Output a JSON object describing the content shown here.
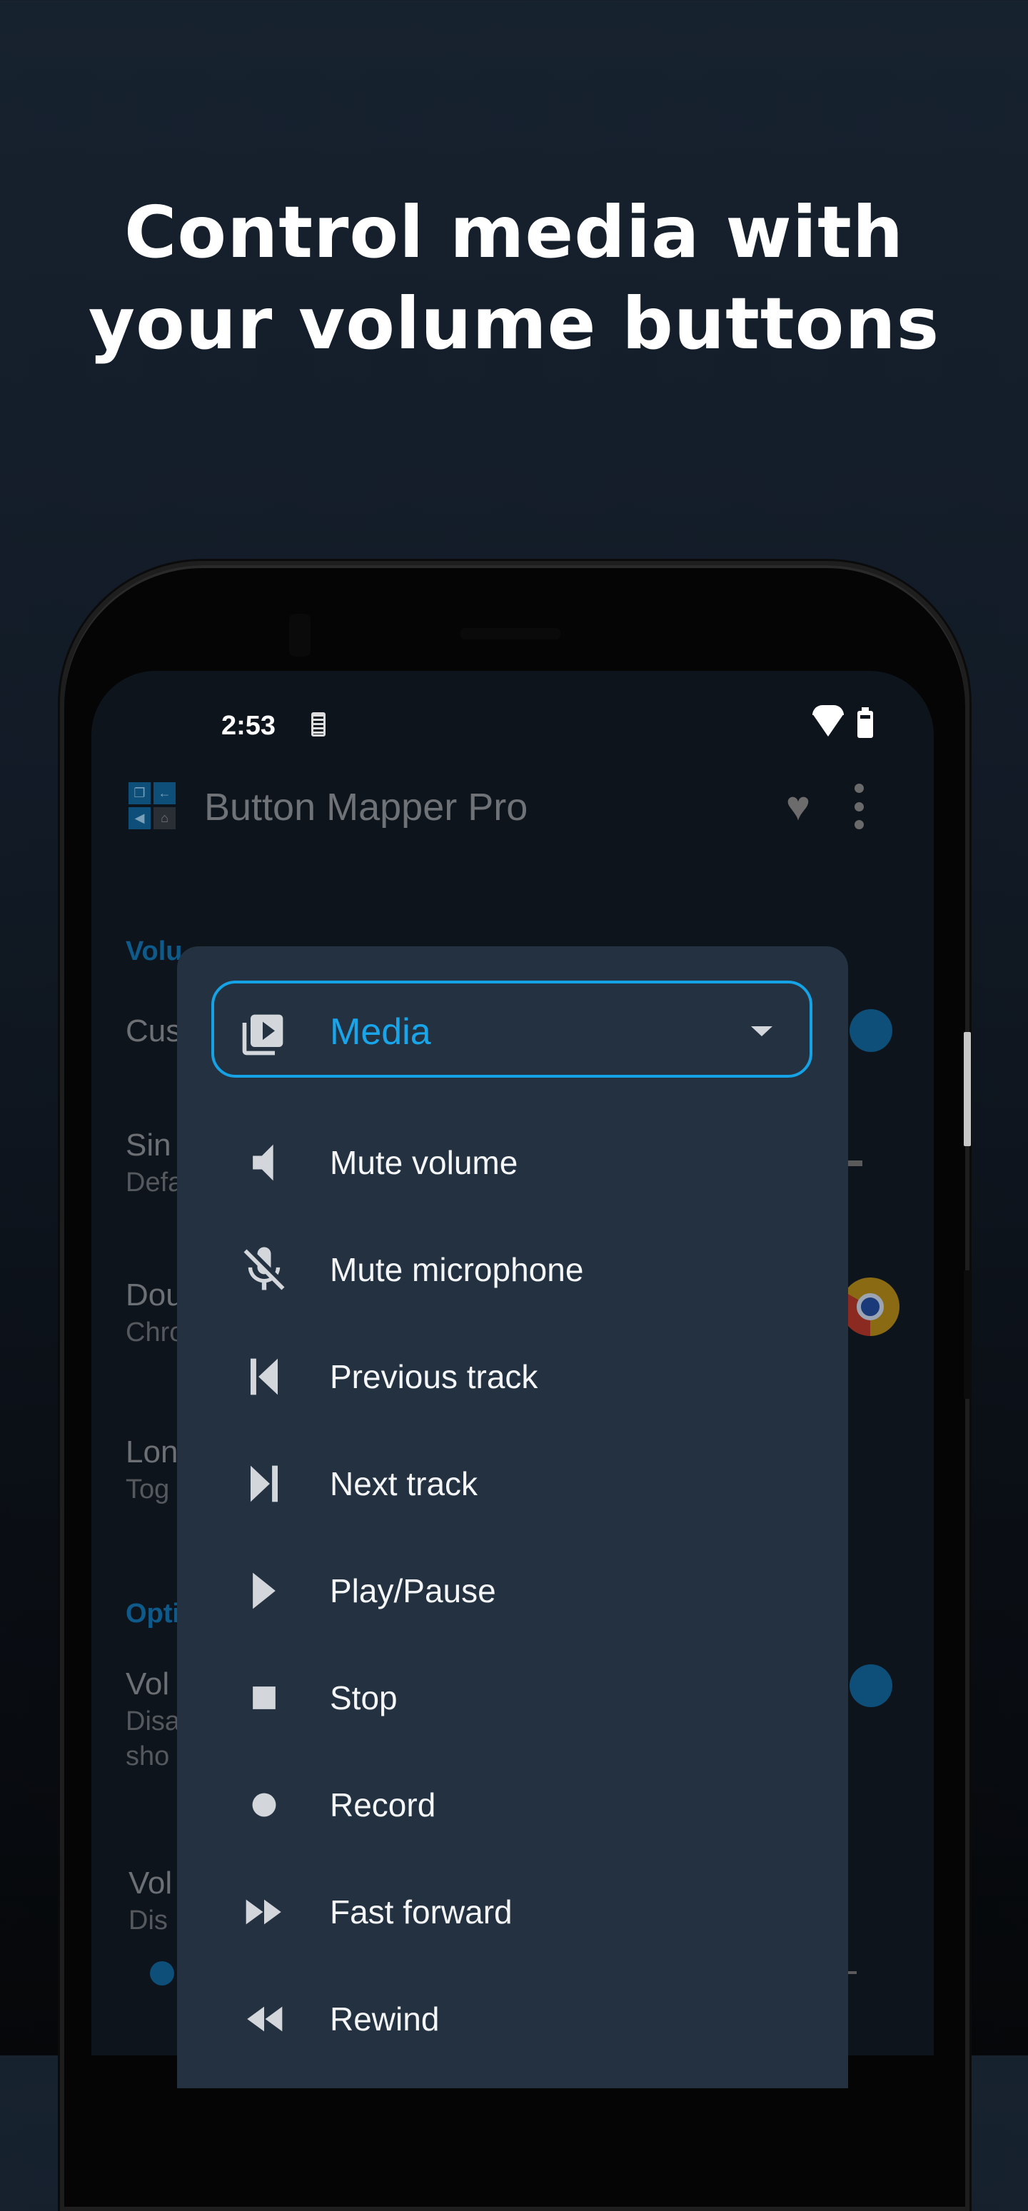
{
  "headline": {
    "line1": "Control media with",
    "line2": "your volume buttons"
  },
  "status_bar": {
    "time": "2:53",
    "icons": [
      "battery-saver-icon",
      "wifi-icon",
      "battery-icon"
    ]
  },
  "app_bar": {
    "title": "Button Mapper Pro",
    "logo_icon": "button-mapper-logo-icon",
    "actions": [
      "heart-icon",
      "more-vert-icon"
    ]
  },
  "background_list": {
    "category_1": "Volu",
    "items": [
      {
        "title": "Cus",
        "subtitle": ""
      },
      {
        "title": "Sin",
        "subtitle": "Defa"
      },
      {
        "title": "Dou",
        "subtitle": "Chro"
      },
      {
        "title": "Lon",
        "subtitle": "Tog"
      }
    ],
    "category_2": "Opti",
    "options": [
      {
        "title": "Vol",
        "subtitle_1": "Disa",
        "subtitle_2": "sho"
      },
      {
        "title": "Vol",
        "subtitle_1": "Dis"
      }
    ]
  },
  "dialog": {
    "dropdown": {
      "selected": "Media",
      "icon": "video-library-icon",
      "accent_color": "#15a3e6"
    },
    "actions": [
      {
        "label": "Mute volume",
        "icon": "volume-mute-icon"
      },
      {
        "label": "Mute microphone",
        "icon": "mic-off-icon"
      },
      {
        "label": "Previous track",
        "icon": "skip-previous-icon"
      },
      {
        "label": "Next track",
        "icon": "skip-next-icon"
      },
      {
        "label": "Play/Pause",
        "icon": "play-icon"
      },
      {
        "label": "Stop",
        "icon": "stop-icon"
      },
      {
        "label": "Record",
        "icon": "record-icon"
      },
      {
        "label": "Fast forward",
        "icon": "fast-forward-icon"
      },
      {
        "label": "Rewind",
        "icon": "rewind-icon"
      }
    ]
  },
  "colors": {
    "accent": "#15a3e6",
    "dialog_bg": "#233140",
    "screen_bg": "#0e141c",
    "icon_fill": "#d3d6db"
  }
}
